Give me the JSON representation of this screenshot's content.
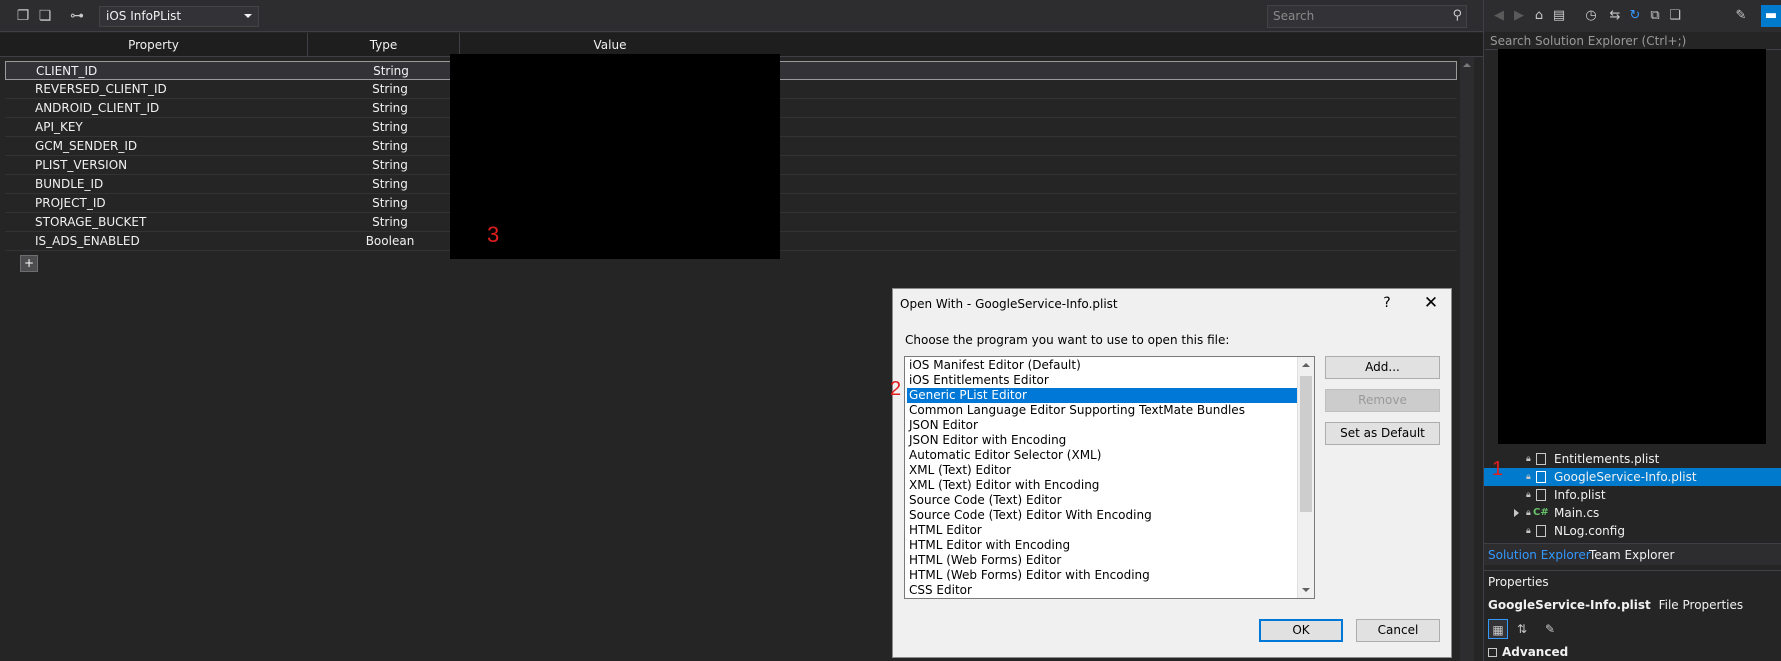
{
  "toolbar": {
    "plist_type": "iOS InfoPList",
    "search_placeholder": "Search"
  },
  "grid": {
    "headers": {
      "property": "Property",
      "type": "Type",
      "value": "Value"
    },
    "rows": [
      {
        "property": "CLIENT_ID",
        "type": "String"
      },
      {
        "property": "REVERSED_CLIENT_ID",
        "type": "String"
      },
      {
        "property": "ANDROID_CLIENT_ID",
        "type": "String"
      },
      {
        "property": "API_KEY",
        "type": "String"
      },
      {
        "property": "GCM_SENDER_ID",
        "type": "String"
      },
      {
        "property": "PLIST_VERSION",
        "type": "String"
      },
      {
        "property": "BUNDLE_ID",
        "type": "String"
      },
      {
        "property": "PROJECT_ID",
        "type": "String"
      },
      {
        "property": "STORAGE_BUCKET",
        "type": "String"
      },
      {
        "property": "IS_ADS_ENABLED",
        "type": "Boolean"
      }
    ],
    "add_button": "+"
  },
  "annotations": {
    "one": "1",
    "two": "2",
    "three": "3"
  },
  "solution_explorer": {
    "search_placeholder": "Search Solution Explorer (Ctrl+;)",
    "items": [
      {
        "label": "Entitlements.plist"
      },
      {
        "label": "GoogleService-Info.plist"
      },
      {
        "label": "Info.plist"
      },
      {
        "label": "Main.cs"
      },
      {
        "label": "NLog.config"
      }
    ],
    "tabs": [
      "Solution Explorer",
      "Team Explorer"
    ]
  },
  "properties": {
    "title": "Properties",
    "subject_name": "GoogleService-Info.plist",
    "subject_kind": "File Properties",
    "section": "Advanced"
  },
  "dialog": {
    "title": "Open With - GoogleService-Info.plist",
    "help": "?",
    "close": "✕",
    "prompt": "Choose the program you want to use to open this file:",
    "programs": [
      "iOS Manifest Editor (Default)",
      "iOS Entitlements Editor",
      "Generic PList Editor",
      "Common Language Editor Supporting TextMate Bundles",
      "JSON Editor",
      "JSON Editor with Encoding",
      "Automatic Editor Selector (XML)",
      "XML (Text) Editor",
      "XML (Text) Editor with Encoding",
      "Source Code (Text) Editor",
      "Source Code (Text) Editor With Encoding",
      "HTML Editor",
      "HTML Editor with Encoding",
      "HTML (Web Forms) Editor",
      "HTML (Web Forms) Editor with Encoding",
      "CSS Editor"
    ],
    "buttons": {
      "add": "Add...",
      "remove": "Remove",
      "set_default": "Set as Default",
      "ok": "OK",
      "cancel": "Cancel"
    }
  },
  "colors": {
    "accent": "#007acc",
    "selection": "#0078d7",
    "annotation": "#e01e1e"
  }
}
